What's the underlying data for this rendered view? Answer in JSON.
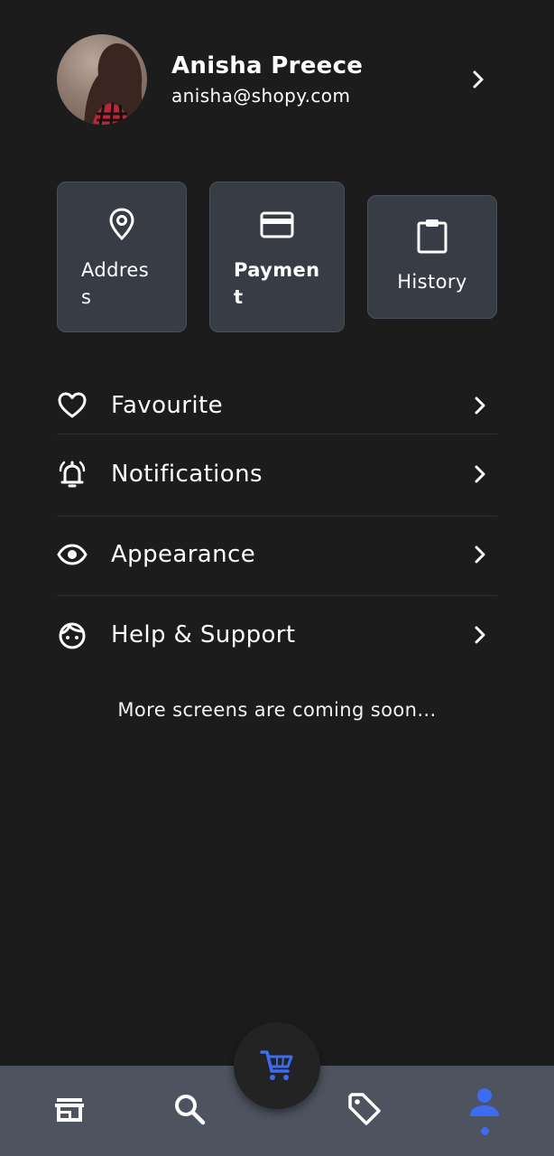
{
  "profile": {
    "name": "Anisha Preece",
    "email": "anisha@shopy.com"
  },
  "quick_actions": [
    {
      "label": "Address",
      "icon": "location-pin-icon"
    },
    {
      "label": "Payment",
      "icon": "credit-card-icon"
    },
    {
      "label": "History",
      "icon": "clipboard-icon"
    }
  ],
  "menu": [
    {
      "label": "Favourite",
      "icon": "heart-icon"
    },
    {
      "label": "Notifications",
      "icon": "bell-ringing-icon"
    },
    {
      "label": "Appearance",
      "icon": "eye-icon"
    },
    {
      "label": "Help & Support",
      "icon": "support-face-icon"
    }
  ],
  "footer_note": "More screens are coming soon...",
  "bottom_nav": {
    "items": [
      "store-icon",
      "search-icon",
      "cart-icon",
      "tag-icon",
      "person-icon"
    ],
    "active": "person-icon"
  },
  "colors": {
    "background": "#1c1c1c",
    "card": "#373c45",
    "nav_bar": "#4e5360",
    "accent": "#3d6bf2"
  }
}
